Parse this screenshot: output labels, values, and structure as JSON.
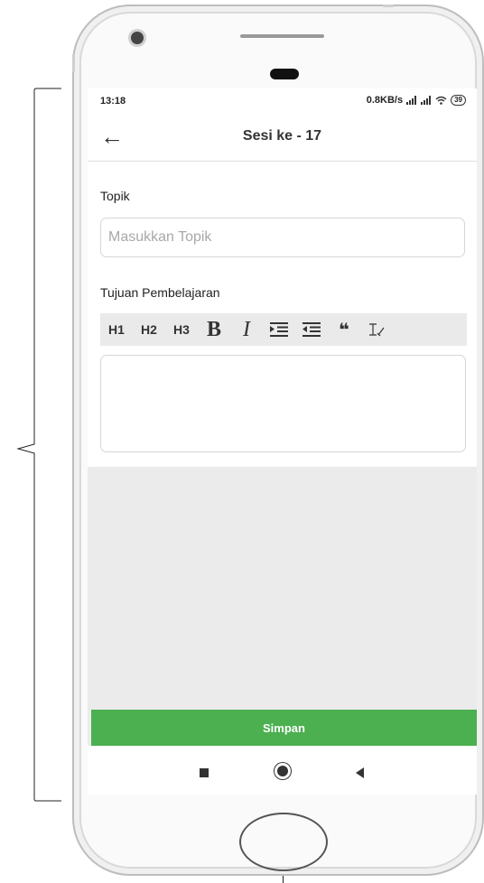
{
  "status_bar": {
    "time": "13:18",
    "network_speed": "0.8KB/s",
    "battery": "39",
    "icons": [
      "signal-icon",
      "signal-icon",
      "wifi-icon",
      "battery-icon"
    ]
  },
  "app_bar": {
    "back_icon": "←",
    "title": "Sesi ke - 17"
  },
  "form": {
    "topic_label": "Topik",
    "topic_placeholder": "Masukkan Topik",
    "topic_value": "",
    "objective_label": "Tujuan Pembelajaran",
    "toolbar": {
      "h1": "H1",
      "h2": "H2",
      "h3": "H3",
      "bold": "B",
      "italic": "I",
      "quote": "❝",
      "icons": [
        "indent-icon",
        "outdent-icon",
        "quote-icon",
        "clear-format-icon"
      ]
    },
    "objective_value": ""
  },
  "save_button": {
    "label": "Simpan",
    "color": "#4caf50"
  },
  "nav_bar": {
    "icons": [
      "recent-apps-icon",
      "home-icon",
      "back-icon"
    ]
  }
}
